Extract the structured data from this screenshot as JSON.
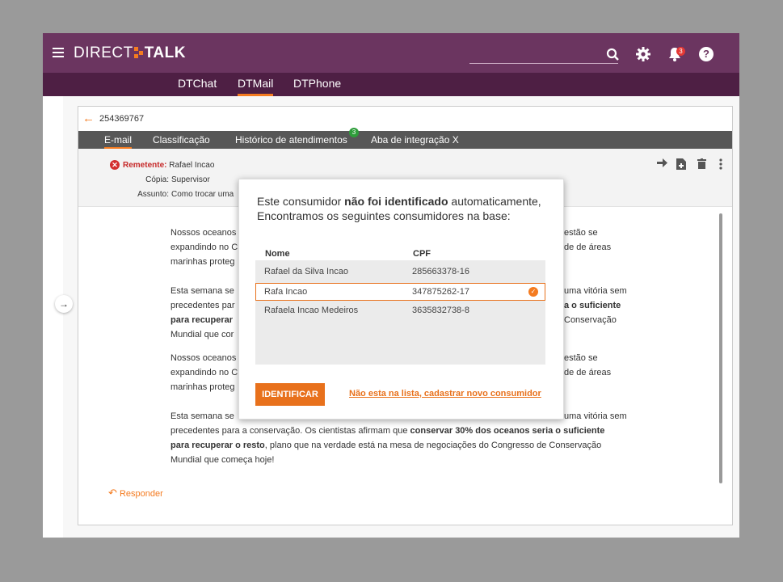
{
  "app": {
    "logo_left": "DIRECT",
    "logo_right": "TALK",
    "notification_count": "3",
    "help_label": "?"
  },
  "nav": {
    "tabs": [
      {
        "label": "DTChat"
      },
      {
        "label": "DTMail"
      },
      {
        "label": "DTPhone"
      }
    ],
    "active": "DTMail"
  },
  "ticket": {
    "back_arrow": "←",
    "id": "254369767"
  },
  "tabs": {
    "items": [
      {
        "label": "E-mail"
      },
      {
        "label": "Classificação"
      },
      {
        "label": "Histórico de atendimentos"
      },
      {
        "label": "Aba de integração X"
      }
    ],
    "history_badge": "3"
  },
  "email": {
    "sender_label": "Remetente:",
    "sender": "Rafael Incao",
    "cc_label": "Cópia:",
    "cc": "Supervisor",
    "subject_label": "Assunto:",
    "subject": "Como trocar uma",
    "p1_left_1": "Nossos oceanos",
    "p1_left_2": "expandindo no C",
    "p1_left_3": "marinhas proteg",
    "p1_right_1": "estão se",
    "p1_right_2": "de de áreas",
    "p2_left_1": "Esta semana se",
    "p2_left_2": "precedentes par",
    "p2_left_3": "para recuperar",
    "p2_left_4": "Mundial que cor",
    "p2_right_1": "uma vitória sem",
    "p2_right_2": "a o suficiente",
    "p2_right_3": "Conservação",
    "p3_left_1": "Nossos oceanos",
    "p3_left_2": "expandindo no C",
    "p3_left_3": "marinhas proteg",
    "p3_right_1": "estão se",
    "p3_right_2": "de de áreas",
    "p4_line1_left": "Esta semana se",
    "p4_line1_right": "uma vitória sem",
    "p4_line2_a": "precedentes para a conservação. Os cientistas afirmam que ",
    "p4_line2_b": "conservar 30% dos oceanos seria o suficiente",
    "p4_line3_a": "para recuperar o resto",
    "p4_line3_b": ", plano que na verdade está na mesa de negociações do Congresso de Conservação",
    "p4_line4": "Mundial que começa hoje!",
    "reply_label": "Responder"
  },
  "modal": {
    "msg_1": "Este consumidor ",
    "msg_bold": "não foi identificado",
    "msg_2": " automaticamente,",
    "msg_3": "Encontramos os seguintes consumidores na base:",
    "col_name": "Nome",
    "col_cpf": "CPF",
    "rows": [
      {
        "name": "Rafael da Silva Incao",
        "cpf": "285663378-16"
      },
      {
        "name": "Rafa Incao",
        "cpf": "347875262-17"
      },
      {
        "name": "Rafaela Incao Medeiros",
        "cpf": "3635832738-8"
      }
    ],
    "selected_row": 1,
    "identify_label": "IDENTIFICAR",
    "new_consumer_link": "Não esta na lista, cadastrar novo consumidor"
  },
  "colors": {
    "topbar": "#6b3560",
    "navbar": "#4e1f44",
    "accent": "#f47b20"
  }
}
